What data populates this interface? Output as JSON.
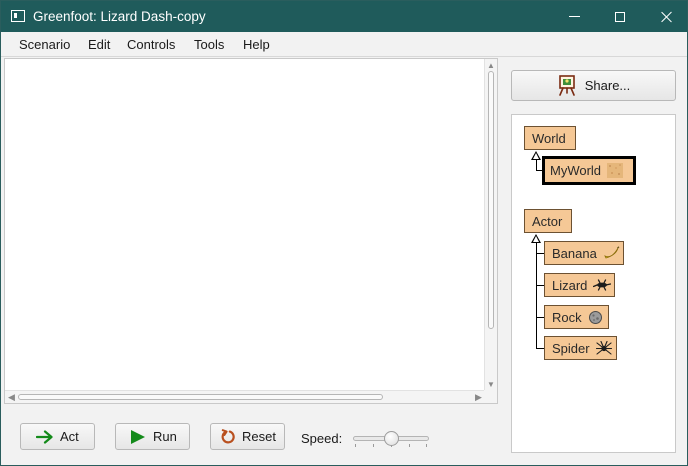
{
  "window": {
    "title": "Greenfoot: Lizard Dash-copy",
    "controls": [
      "minimize",
      "maximize",
      "close"
    ]
  },
  "menu": [
    {
      "label": "Scenario"
    },
    {
      "label": "Edit"
    },
    {
      "label": "Controls"
    },
    {
      "label": "Tools"
    },
    {
      "label": "Help"
    }
  ],
  "controls": {
    "act_label": "Act",
    "run_label": "Run",
    "reset_label": "Reset",
    "speed_label": "Speed:",
    "speed_value": 0.5
  },
  "share": {
    "label": "Share..."
  },
  "classes": {
    "world": {
      "label": "World",
      "subclasses": [
        {
          "label": "MyWorld",
          "selected": true,
          "icon": "sand-texture-icon"
        }
      ]
    },
    "actor": {
      "label": "Actor",
      "subclasses": [
        {
          "label": "Banana",
          "icon": "banana-icon"
        },
        {
          "label": "Lizard",
          "icon": "lizard-icon"
        },
        {
          "label": "Rock",
          "icon": "rock-icon"
        },
        {
          "label": "Spider",
          "icon": "spider-icon"
        }
      ]
    }
  },
  "colors": {
    "titlebar": "#1f5b5b",
    "class_fill": "#f5c896",
    "class_border": "#6c5132"
  }
}
